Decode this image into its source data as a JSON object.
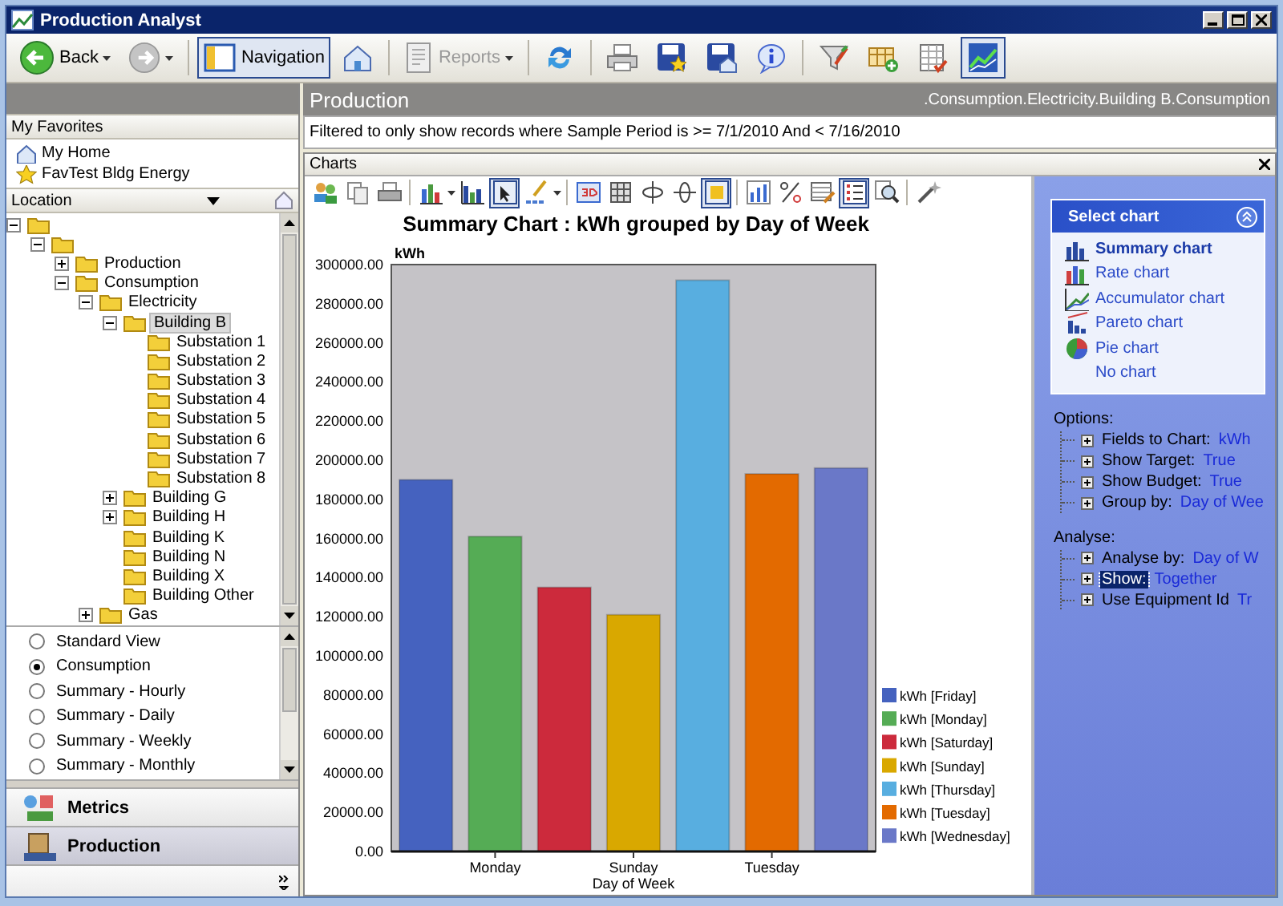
{
  "window": {
    "title": "Production Analyst"
  },
  "toolbar": {
    "back": {
      "label": "Back",
      "disabled": false
    },
    "forward": {
      "disabled": true
    },
    "navigation": {
      "label": "Navigation",
      "selected": true
    },
    "reports": {
      "label": "Reports",
      "disabled": true
    },
    "chart_view": {
      "selected": true
    }
  },
  "favorites": {
    "title": "My Favorites",
    "items": [
      {
        "label": "My Home"
      },
      {
        "label": "FavTest Bldg Energy"
      }
    ]
  },
  "location": {
    "title": "Location",
    "tree": [
      {
        "expanded": true,
        "selected": false,
        "children": [
          {
            "expanded": true,
            "selected": false,
            "children": [
              {
                "label": "Production",
                "expanded": false,
                "selected": false
              },
              {
                "label": "Consumption",
                "expanded": true,
                "selected": false,
                "children": [
                  {
                    "label": "Electricity",
                    "expanded": true,
                    "selected": false,
                    "children": [
                      {
                        "label": "Building B",
                        "expanded": true,
                        "selected": true,
                        "children": [
                          {
                            "label": "Substation 1",
                            "selected": false
                          },
                          {
                            "label": "Substation 2",
                            "selected": false
                          },
                          {
                            "label": "Substation 3",
                            "selected": false
                          },
                          {
                            "label": "Substation 4",
                            "selected": false
                          },
                          {
                            "label": "Substation 5",
                            "selected": false
                          },
                          {
                            "label": "Substation 6",
                            "selected": false
                          },
                          {
                            "label": "Substation 7",
                            "selected": false
                          },
                          {
                            "label": "Substation 8",
                            "selected": false
                          }
                        ]
                      },
                      {
                        "label": "Building G",
                        "expanded": false,
                        "selected": false
                      },
                      {
                        "label": "Building H",
                        "expanded": false,
                        "selected": false
                      },
                      {
                        "label": "Building K",
                        "selected": false
                      },
                      {
                        "label": "Building N",
                        "selected": false
                      },
                      {
                        "label": "Building X",
                        "selected": false
                      },
                      {
                        "label": "Building Other",
                        "selected": false
                      }
                    ]
                  },
                  {
                    "label": "Gas",
                    "expanded": false,
                    "selected": false
                  }
                ]
              }
            ]
          }
        ]
      }
    ]
  },
  "views": [
    {
      "label": "Standard View",
      "selected": false
    },
    {
      "label": "Consumption",
      "selected": true
    },
    {
      "label": "Summary - Hourly",
      "selected": false
    },
    {
      "label": "Summary - Daily",
      "selected": false
    },
    {
      "label": "Summary - Weekly",
      "selected": false
    },
    {
      "label": "Summary - Monthly",
      "selected": false
    }
  ],
  "nav_buttons": [
    {
      "label": "Metrics",
      "selected": false
    },
    {
      "label": "Production",
      "selected": true
    }
  ],
  "header": {
    "title": "Production",
    "path": ".Consumption.Electricity.Building B.Consumption"
  },
  "filter_text": "Filtered to only show records where Sample Period is >= 7/1/2010 And < 7/16/2010",
  "charts_panel": {
    "title": "Charts",
    "toolbar": [
      {
        "selected": false
      },
      {
        "selected": false
      },
      {
        "selected": false
      },
      {
        "selected": false
      },
      {
        "selected": false
      },
      {
        "selected": true
      },
      {
        "selected": false
      },
      {
        "selected": false
      },
      {
        "selected": false
      },
      {
        "selected": false
      },
      {
        "selected": false
      },
      {
        "selected": true
      },
      {
        "selected": false
      },
      {
        "selected": false
      },
      {
        "selected": false
      },
      {
        "selected": true
      },
      {
        "selected": false
      },
      {
        "selected": false
      }
    ],
    "chart_data": {
      "type": "bar",
      "title": "Summary Chart : kWh grouped by Day of Week",
      "xlabel": "Day of Week",
      "ylabel": "kWh",
      "categories": [
        null,
        "Monday",
        null,
        "Sunday",
        null,
        "Tuesday",
        null
      ],
      "legend": "right",
      "series": [
        {
          "name": "kWh [Friday]",
          "color": "#4562bf",
          "values": [
            190000,
            null,
            null,
            null,
            null,
            null,
            null
          ]
        },
        {
          "name": "kWh [Monday]",
          "color": "#55ac55",
          "values": [
            null,
            161000,
            null,
            null,
            null,
            null,
            null
          ]
        },
        {
          "name": "kWh [Saturday]",
          "color": "#cc2a3c",
          "values": [
            null,
            null,
            135000,
            null,
            null,
            null,
            null
          ]
        },
        {
          "name": "kWh [Sunday]",
          "color": "#d9a800",
          "values": [
            null,
            null,
            null,
            121000,
            null,
            null,
            null
          ]
        },
        {
          "name": "kWh [Thursday]",
          "color": "#58aee0",
          "values": [
            null,
            null,
            null,
            null,
            292000,
            null,
            null
          ]
        },
        {
          "name": "kWh [Tuesday]",
          "color": "#e36a00",
          "values": [
            null,
            null,
            null,
            null,
            null,
            193000,
            null
          ]
        },
        {
          "name": "kWh [Wednesday]",
          "color": "#6a78c8",
          "values": [
            null,
            null,
            null,
            null,
            null,
            null,
            196000
          ]
        }
      ],
      "ylim": [
        0,
        300000
      ],
      "yticks": [
        {
          "value": 0,
          "label": "0.00"
        },
        {
          "value": 20000,
          "label": "20000.00"
        },
        {
          "value": 40000,
          "label": "40000.00"
        },
        {
          "value": 60000,
          "label": "60000.00"
        },
        {
          "value": 80000,
          "label": "80000.00"
        },
        {
          "value": 100000,
          "label": "100000.00"
        },
        {
          "value": 120000,
          "label": "120000.00"
        },
        {
          "value": 140000,
          "label": "140000.00"
        },
        {
          "value": 160000,
          "label": "160000.00"
        },
        {
          "value": 180000,
          "label": "180000.00"
        },
        {
          "value": 200000,
          "label": "200000.00"
        },
        {
          "value": 220000,
          "label": "220000.00"
        },
        {
          "value": 240000,
          "label": "240000.00"
        },
        {
          "value": 260000,
          "label": "260000.00"
        },
        {
          "value": 280000,
          "label": "280000.00"
        },
        {
          "value": 300000,
          "label": "300000.00"
        }
      ]
    }
  },
  "select_chart": {
    "title": "Select chart",
    "items": [
      {
        "label": "Summary chart",
        "selected": true
      },
      {
        "label": "Rate chart",
        "selected": false
      },
      {
        "label": "Accumulator chart",
        "selected": false
      },
      {
        "label": "Pareto chart",
        "selected": false
      },
      {
        "label": "Pie chart",
        "selected": false
      },
      {
        "label": "No chart",
        "selected": false
      }
    ]
  },
  "options": {
    "title": "Options:",
    "items": [
      {
        "label": "Fields to Chart:",
        "value": "kWh",
        "selected": false
      },
      {
        "label": "Show Target:",
        "value": "True",
        "selected": false
      },
      {
        "label": "Show Budget:",
        "value": "True",
        "selected": false
      },
      {
        "label": "Group by:",
        "value": "Day of Wee",
        "selected": false
      }
    ]
  },
  "analyse": {
    "title": "Analyse:",
    "items": [
      {
        "label": "Analyse by:",
        "value": "Day of W",
        "selected": false
      },
      {
        "label": "Show:",
        "value": "Together",
        "selected": true
      },
      {
        "label": "Use Equipment Id",
        "value": "Tr",
        "selected": false
      }
    ]
  }
}
